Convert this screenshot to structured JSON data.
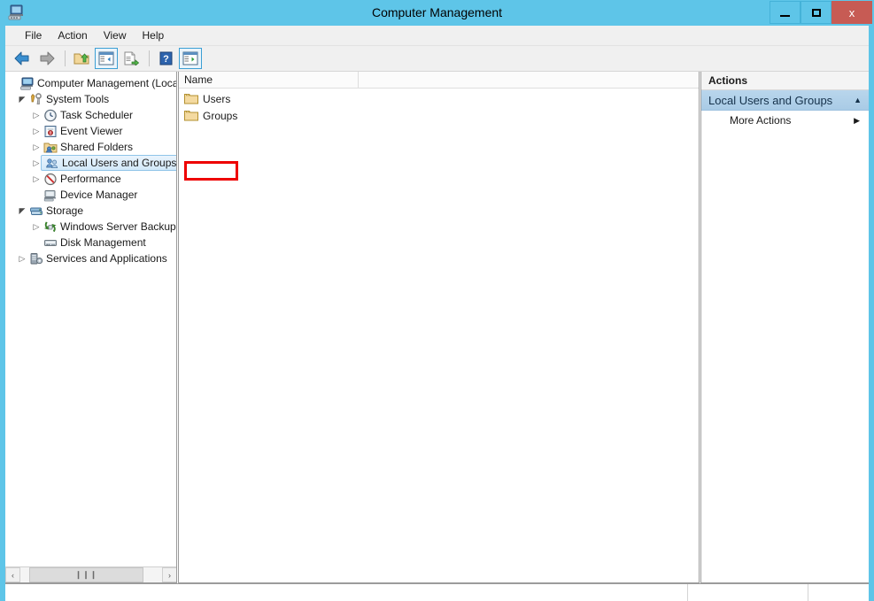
{
  "window": {
    "title": "Computer Management",
    "icon": "computer-management-icon",
    "accent_color": "#5ec5e8",
    "close_color": "#c75b54",
    "controls": {
      "minimize": "—",
      "maximize": "□",
      "close": "x"
    }
  },
  "menubar": {
    "items": [
      {
        "label": "File",
        "name": "menu-file"
      },
      {
        "label": "Action",
        "name": "menu-action"
      },
      {
        "label": "View",
        "name": "menu-view"
      },
      {
        "label": "Help",
        "name": "menu-help"
      }
    ]
  },
  "toolbar": {
    "buttons": [
      {
        "name": "back-button",
        "icon": "back-arrow-icon",
        "framed": false
      },
      {
        "name": "forward-button",
        "icon": "forward-arrow-icon",
        "framed": false
      },
      {
        "name": "up-one-level-button",
        "icon": "folder-up-icon",
        "framed": false
      },
      {
        "name": "show-hide-console-tree-button",
        "icon": "console-tree-icon",
        "framed": true
      },
      {
        "name": "export-list-button",
        "icon": "export-list-icon",
        "framed": false
      },
      {
        "name": "help-button",
        "icon": "question-mark-icon",
        "framed": false
      },
      {
        "name": "show-hide-action-pane-button",
        "icon": "action-pane-icon",
        "framed": true
      }
    ]
  },
  "tree": {
    "items": [
      {
        "label": "Computer Management (Local)",
        "indent": 0,
        "arrow": "none",
        "icon": "computer-icon",
        "selected": false,
        "name": "tree-item-computer-management-local"
      },
      {
        "label": "System Tools",
        "indent": 1,
        "arrow": "expanded",
        "icon": "system-tools-icon",
        "selected": false,
        "name": "tree-item-system-tools"
      },
      {
        "label": "Task Scheduler",
        "indent": 2,
        "arrow": "collapsed",
        "icon": "clock-icon",
        "selected": false,
        "name": "tree-item-task-scheduler"
      },
      {
        "label": "Event Viewer",
        "indent": 2,
        "arrow": "collapsed",
        "icon": "event-viewer-icon",
        "selected": false,
        "name": "tree-item-event-viewer"
      },
      {
        "label": "Shared Folders",
        "indent": 2,
        "arrow": "collapsed",
        "icon": "shared-folders-icon",
        "selected": false,
        "name": "tree-item-shared-folders"
      },
      {
        "label": "Local Users and Groups",
        "indent": 2,
        "arrow": "collapsed",
        "icon": "users-group-icon",
        "selected": true,
        "name": "tree-item-local-users-and-groups"
      },
      {
        "label": "Performance",
        "indent": 2,
        "arrow": "collapsed",
        "icon": "performance-icon",
        "selected": false,
        "name": "tree-item-performance"
      },
      {
        "label": "Device Manager",
        "indent": 2,
        "arrow": "none",
        "icon": "device-manager-icon",
        "selected": false,
        "name": "tree-item-device-manager"
      },
      {
        "label": "Storage",
        "indent": 1,
        "arrow": "expanded",
        "icon": "storage-icon",
        "selected": false,
        "name": "tree-item-storage"
      },
      {
        "label": "Windows Server Backup",
        "indent": 2,
        "arrow": "collapsed",
        "icon": "backup-icon",
        "selected": false,
        "name": "tree-item-windows-server-backup"
      },
      {
        "label": "Disk Management",
        "indent": 2,
        "arrow": "none",
        "icon": "disk-management-icon",
        "selected": false,
        "name": "tree-item-disk-management"
      },
      {
        "label": "Services and Applications",
        "indent": 1,
        "arrow": "collapsed",
        "icon": "services-icon",
        "selected": false,
        "name": "tree-item-services-and-applications"
      }
    ],
    "scrollbar": {
      "left_arrow": "‹",
      "right_arrow": "›",
      "thumb_grip": "❙❙❙"
    }
  },
  "list": {
    "columns": [
      {
        "label": "Name",
        "name": "column-header-name"
      },
      {
        "label": "",
        "name": "column-header-blank"
      }
    ],
    "rows": [
      {
        "label": "Users",
        "icon": "folder-icon",
        "highlighted": true,
        "name": "list-item-users"
      },
      {
        "label": "Groups",
        "icon": "folder-icon",
        "highlighted": false,
        "name": "list-item-groups"
      }
    ],
    "highlight_color": "#ee0000"
  },
  "actions": {
    "title": "Actions",
    "group": {
      "label": "Local Users and Groups",
      "collapse_icon": "▲"
    },
    "items": [
      {
        "label": "More Actions",
        "submenu_icon": "▶",
        "name": "action-more-actions"
      }
    ]
  },
  "statusbar": {
    "segments": [
      "",
      "",
      ""
    ]
  }
}
